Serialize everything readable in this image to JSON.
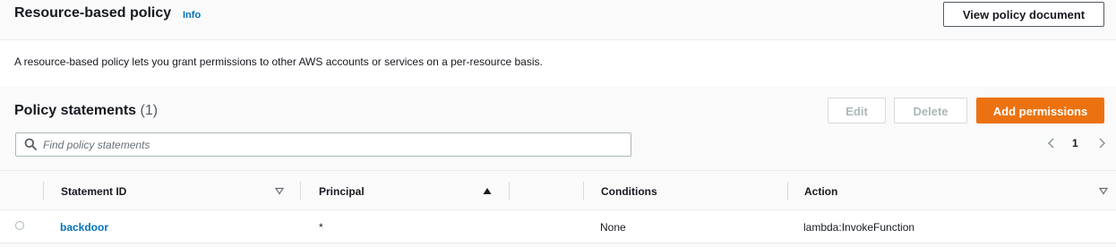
{
  "header": {
    "title": "Resource-based policy",
    "info_label": "Info",
    "view_policy_label": "View policy document"
  },
  "description": "A resource-based policy lets you grant permissions to other AWS accounts or services on a per-resource basis.",
  "statements": {
    "title": "Policy statements",
    "count": "(1)",
    "edit_label": "Edit",
    "delete_label": "Delete",
    "add_label": "Add permissions",
    "search_placeholder": "Find policy statements",
    "search_value": "",
    "page": "1"
  },
  "table": {
    "columns": [
      "Statement ID",
      "Principal",
      "Conditions",
      "Action"
    ],
    "rows": [
      {
        "statement_id": "backdoor",
        "principal": "*",
        "conditions": "None",
        "action": "lambda:InvokeFunction"
      }
    ]
  },
  "colors": {
    "primary_button": "#ec7211",
    "link": "#0073bb",
    "text": "#16191f",
    "disabled_text": "#aab7b8",
    "panel_background": "#fafafa"
  },
  "icons": {
    "search": "search-icon",
    "sort_statement_id": "caret-down-outline-icon",
    "sort_principal": "caret-up-filled-icon",
    "sort_action": "caret-down-outline-icon",
    "pager_prev": "chevron-left-icon",
    "pager_next": "chevron-right-icon"
  }
}
